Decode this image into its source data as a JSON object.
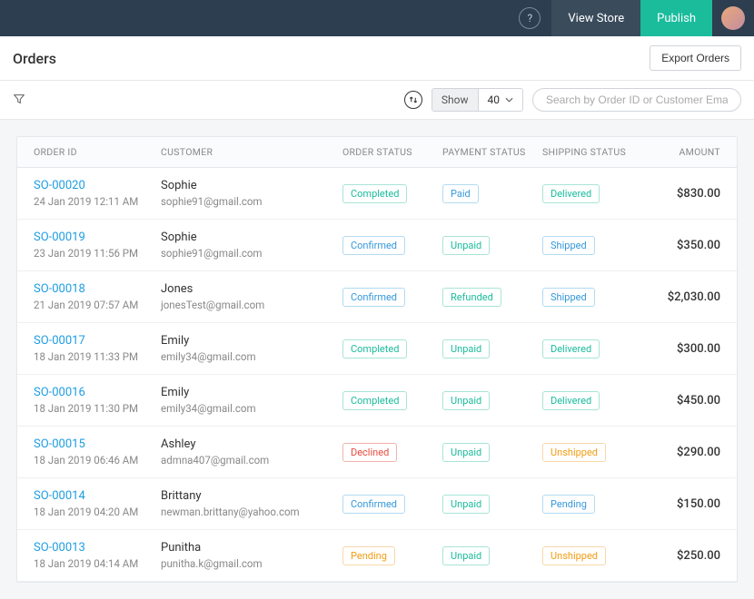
{
  "topbar": {
    "view_store": "View Store",
    "publish": "Publish"
  },
  "header": {
    "title": "Orders",
    "export_label": "Export Orders"
  },
  "toolbar": {
    "show_label": "Show",
    "show_value": "40",
    "search_placeholder": "Search by Order ID or Customer Email"
  },
  "columns": {
    "order_id": "ORDER ID",
    "customer": "CUSTOMER",
    "order_status": "ORDER STATUS",
    "payment_status": "PAYMENT STATUS",
    "shipping_status": "SHIPPING STATUS",
    "amount": "AMOUNT"
  },
  "orders": [
    {
      "id": "SO-00020",
      "date": "24 Jan 2019 12:11 AM",
      "customer": "Sophie",
      "email": "sophie91@gmail.com",
      "order_status": "Completed",
      "order_status_color": "green",
      "payment_status": "Paid",
      "payment_status_color": "blue",
      "shipping_status": "Delivered",
      "shipping_status_color": "green",
      "amount": "$830.00"
    },
    {
      "id": "SO-00019",
      "date": "23 Jan 2019 11:56 PM",
      "customer": "Sophie",
      "email": "sophie91@gmail.com",
      "order_status": "Confirmed",
      "order_status_color": "blue",
      "payment_status": "Unpaid",
      "payment_status_color": "green",
      "shipping_status": "Shipped",
      "shipping_status_color": "blue",
      "amount": "$350.00"
    },
    {
      "id": "SO-00018",
      "date": "21 Jan 2019 07:57 AM",
      "customer": "Jones",
      "email": "jonesTest@gmail.com",
      "order_status": "Confirmed",
      "order_status_color": "blue",
      "payment_status": "Refunded",
      "payment_status_color": "green",
      "shipping_status": "Shipped",
      "shipping_status_color": "blue",
      "amount": "$2,030.00"
    },
    {
      "id": "SO-00017",
      "date": "18 Jan 2019 11:33 PM",
      "customer": "Emily",
      "email": "emily34@gmail.com",
      "order_status": "Completed",
      "order_status_color": "green",
      "payment_status": "Unpaid",
      "payment_status_color": "green",
      "shipping_status": "Delivered",
      "shipping_status_color": "green",
      "amount": "$300.00"
    },
    {
      "id": "SO-00016",
      "date": "18 Jan 2019 11:30 PM",
      "customer": "Emily",
      "email": "emily34@gmail.com",
      "order_status": "Completed",
      "order_status_color": "green",
      "payment_status": "Unpaid",
      "payment_status_color": "green",
      "shipping_status": "Delivered",
      "shipping_status_color": "green",
      "amount": "$450.00"
    },
    {
      "id": "SO-00015",
      "date": "18 Jan 2019 06:46 AM",
      "customer": "Ashley",
      "email": "admna407@gmail.com",
      "order_status": "Declined",
      "order_status_color": "red",
      "payment_status": "Unpaid",
      "payment_status_color": "green",
      "shipping_status": "Unshipped",
      "shipping_status_color": "orange",
      "amount": "$290.00"
    },
    {
      "id": "SO-00014",
      "date": "18 Jan 2019 04:20 AM",
      "customer": "Brittany",
      "email": "newman.brittany@yahoo.com",
      "order_status": "Confirmed",
      "order_status_color": "blue",
      "payment_status": "Unpaid",
      "payment_status_color": "green",
      "shipping_status": "Pending",
      "shipping_status_color": "blue",
      "amount": "$150.00"
    },
    {
      "id": "SO-00013",
      "date": "18 Jan 2019 04:14 AM",
      "customer": "Punitha",
      "email": "punitha.k@gmail.com",
      "order_status": "Pending",
      "order_status_color": "orange",
      "payment_status": "Unpaid",
      "payment_status_color": "green",
      "shipping_status": "Unshipped",
      "shipping_status_color": "orange",
      "amount": "$250.00"
    }
  ]
}
